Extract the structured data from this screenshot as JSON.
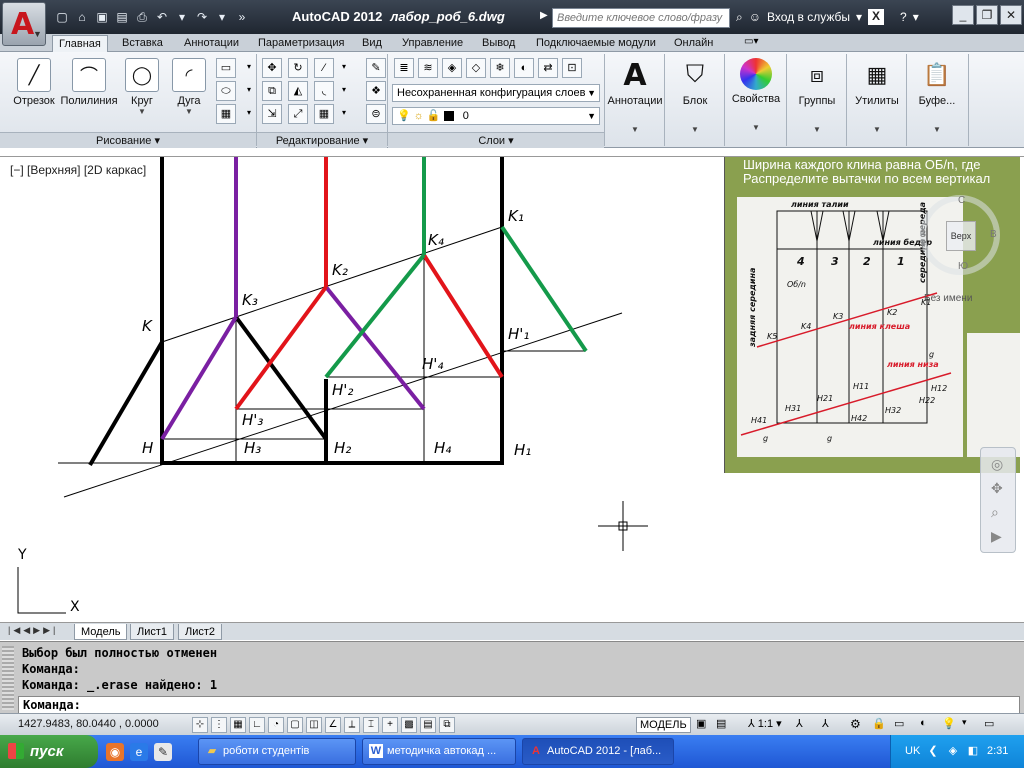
{
  "title": {
    "app": "AutoCAD 2012",
    "document": "лабор_роб_6.dwg",
    "search_placeholder": "Введите ключевое слово/фразу",
    "signin": "Вход в службы"
  },
  "tabs": [
    "Главная",
    "Вставка",
    "Аннотации",
    "Параметризация",
    "Вид",
    "Управление",
    "Вывод",
    "Подключаемые модули",
    "Онлайн"
  ],
  "draw_panel": {
    "tools": [
      "Отрезок",
      "Полилиния",
      "Круг",
      "Дуга"
    ],
    "title": "Рисование"
  },
  "modify_panel": {
    "title": "Редактирование"
  },
  "layers_panel": {
    "title": "Слои",
    "layer_state": "Несохраненная конфигурация слоев",
    "current_layer": "0"
  },
  "big_panels": [
    "Аннотации",
    "Блок",
    "Свойства",
    "Группы",
    "Утилиты",
    "Буфе..."
  ],
  "viewport_label": "[−] [Верхняя] [2D каркас]",
  "drawing_labels": [
    "K",
    "H",
    "K₃",
    "H'₃",
    "H₃",
    "K₂",
    "H'₂",
    "H₂",
    "K₄",
    "H'₄",
    "H₄",
    "K₁",
    "H'₁",
    "H₁",
    "Y",
    "X"
  ],
  "image_panel": {
    "header_line1": "Ширина каждого клина равна ОБ/n, где",
    "header_line2": "Распределите вытачки по всем вертикал",
    "waist_line": "линия талии",
    "hip_line": "линия бедер",
    "back_center": "задняя середина",
    "front_center": "середина переда",
    "wedge_numbers": [
      "4",
      "3",
      "2",
      "1"
    ],
    "ob_label": "Об/n",
    "flare_line": "линия клеша",
    "bottom_line": "линия низа",
    "k_labels": [
      "K5",
      "K4",
      "K3",
      "K2",
      "K1"
    ],
    "h_labels": [
      "H41",
      "H31",
      "H21",
      "H11",
      "H12",
      "H22",
      "H32",
      "H42"
    ],
    "g_label": "g"
  },
  "viewcube": {
    "face": "Верх",
    "west": "З",
    "east": "В",
    "south": "Ю",
    "north": "С"
  },
  "noname": "Без имени",
  "layout_tabs": [
    "Модель",
    "Лист1",
    "Лист2"
  ],
  "command": {
    "lines": [
      "Выбор был полностью отменен",
      "Команда:",
      "Команда: _.erase найдено: 1"
    ],
    "prompt": "Команда:"
  },
  "status": {
    "coords": "1427.9483, 80.0440 , 0.0000",
    "model": "МОДЕЛЬ",
    "scale": "1:1"
  },
  "taskbar": {
    "start": "пуск",
    "tasks": [
      "роботи студентів",
      "методичка автокад ...",
      "AutoCAD 2012 - [лаб..."
    ],
    "lang": "UK",
    "clock": "2:31"
  }
}
